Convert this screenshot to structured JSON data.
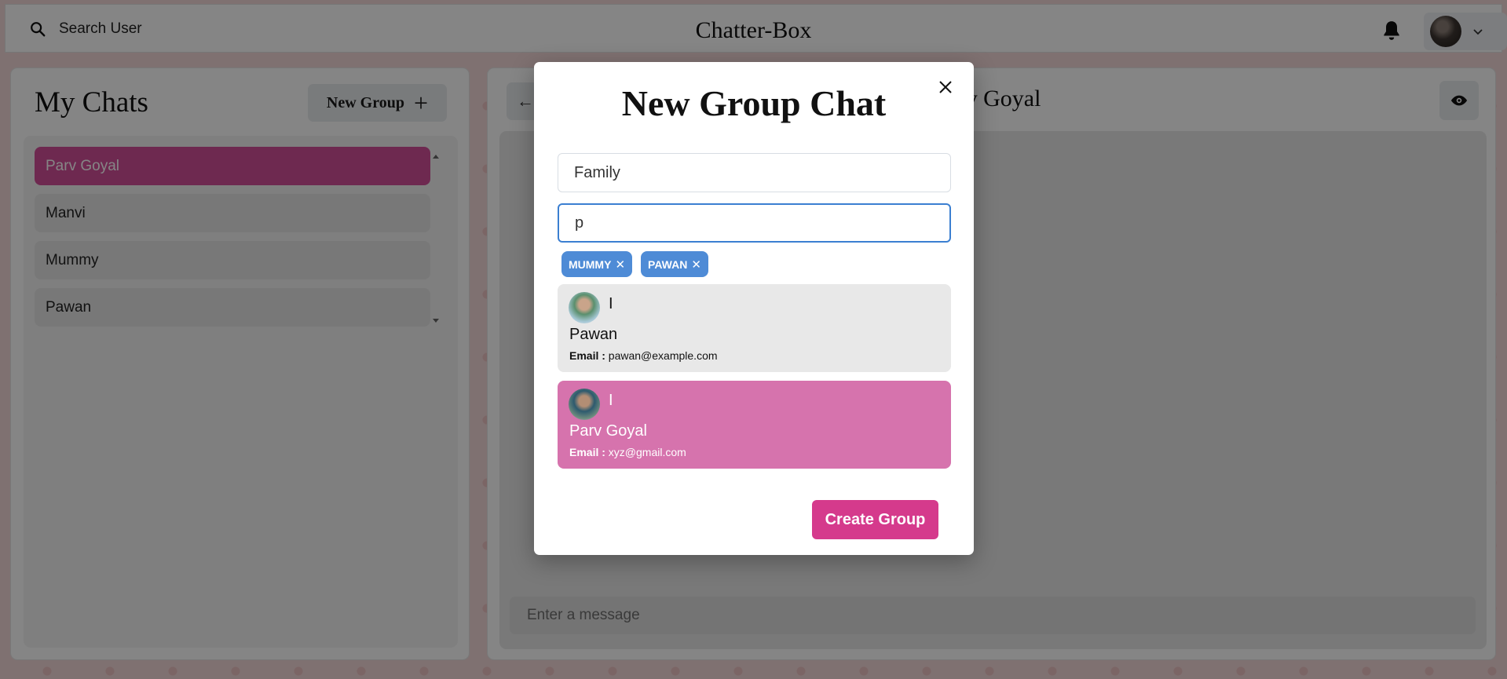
{
  "header": {
    "search_label": "Search User",
    "app_title": "Chatter-Box"
  },
  "chats": {
    "title": "My Chats",
    "new_group_label": "New Group",
    "items": [
      {
        "label": "Parv Goyal",
        "active": true
      },
      {
        "label": "Manvi",
        "active": false
      },
      {
        "label": "Mummy",
        "active": false
      },
      {
        "label": "Pawan",
        "active": false
      }
    ]
  },
  "chat_box": {
    "chat_name": "Parv Goyal",
    "message_placeholder": "Enter a message"
  },
  "modal": {
    "title": "New Group Chat",
    "group_name_value": "Family",
    "user_search_value": "p",
    "selected_users": [
      "MUMMY",
      "PAWAN"
    ],
    "results": [
      {
        "initial": "I",
        "name": "Pawan",
        "email_label": "Email :",
        "email": "pawan@example.com"
      },
      {
        "initial": "I",
        "name": "Parv Goyal",
        "email_label": "Email :",
        "email": "xyz@gmail.com"
      }
    ],
    "create_label": "Create Group"
  },
  "colors": {
    "accent_pink": "#d44f9a",
    "chip_blue": "#4e8bd6",
    "create_button": "#d53a8c"
  }
}
